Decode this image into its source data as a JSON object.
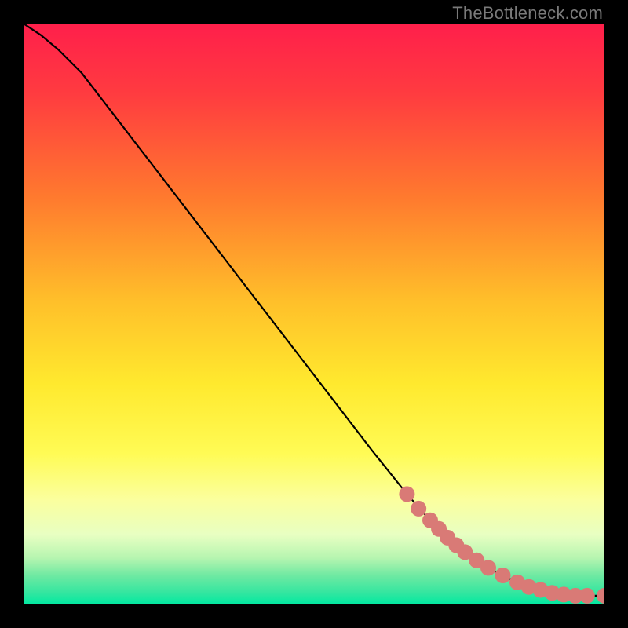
{
  "attribution_text": "TheBottleneck.com",
  "chart_data": {
    "type": "line",
    "title": "",
    "xlabel": "",
    "ylabel": "",
    "xlim": [
      0,
      100
    ],
    "ylim": [
      0,
      100
    ],
    "gradient_stops": [
      {
        "offset": 0,
        "color": "#ff1f4b"
      },
      {
        "offset": 12,
        "color": "#ff3b40"
      },
      {
        "offset": 30,
        "color": "#ff7a2e"
      },
      {
        "offset": 48,
        "color": "#ffc02a"
      },
      {
        "offset": 62,
        "color": "#ffe92e"
      },
      {
        "offset": 74,
        "color": "#fffb55"
      },
      {
        "offset": 82,
        "color": "#fbff9e"
      },
      {
        "offset": 88,
        "color": "#e8ffc2"
      },
      {
        "offset": 92,
        "color": "#b6f5b0"
      },
      {
        "offset": 95,
        "color": "#6fe9a2"
      },
      {
        "offset": 98,
        "color": "#33e6a0"
      },
      {
        "offset": 100,
        "color": "#00e9a1"
      }
    ],
    "series": [
      {
        "name": "curve",
        "x": [
          0.0,
          3.0,
          6.0,
          10.0,
          20.0,
          30.0,
          40.0,
          50.0,
          60.0,
          66.0,
          70.0,
          73.0,
          76.0,
          79.0,
          82.0,
          85.0,
          87.0,
          89.0,
          91.0,
          93.0,
          95.0,
          97.0,
          100.0
        ],
        "y": [
          100.0,
          98.0,
          95.5,
          91.5,
          78.5,
          65.5,
          52.5,
          39.5,
          26.5,
          19.0,
          14.5,
          11.5,
          9.0,
          7.0,
          5.2,
          3.8,
          3.0,
          2.5,
          2.0,
          1.7,
          1.5,
          1.5,
          1.5
        ]
      }
    ],
    "markers": {
      "name": "points",
      "x": [
        66.0,
        68.0,
        70.0,
        71.5,
        73.0,
        74.5,
        76.0,
        78.0,
        80.0,
        82.5,
        85.0,
        87.0,
        89.0,
        91.0,
        93.0,
        95.0,
        97.0,
        100.0
      ],
      "y": [
        19.0,
        16.5,
        14.5,
        13.0,
        11.5,
        10.2,
        9.0,
        7.6,
        6.3,
        5.0,
        3.8,
        3.0,
        2.5,
        2.0,
        1.7,
        1.5,
        1.5,
        1.5
      ],
      "color": "#d97a76",
      "radius_px": 10
    }
  }
}
